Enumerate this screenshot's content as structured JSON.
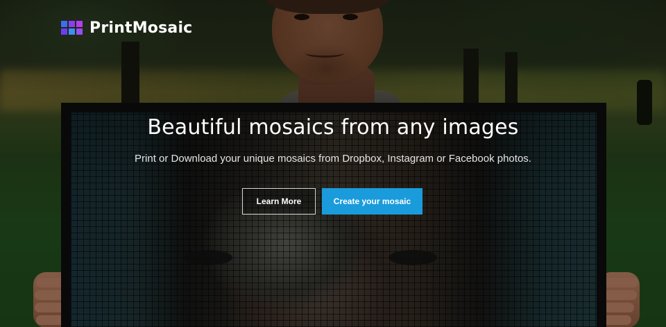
{
  "brand": {
    "name": "PrintMosaic",
    "logo_icon": "mosaic-grid-icon",
    "logo_colors": [
      "#3d6df2",
      "#8a3df2",
      "#b23df2",
      "#6d3df2",
      "#3d8ff2",
      "#9a4df2"
    ]
  },
  "hero": {
    "title": "Beautiful mosaics from any images",
    "subtitle": "Print or Download your unique mosaics from Dropbox, Instagram or Facebook photos."
  },
  "buttons": {
    "learn_more": "Learn More",
    "create": "Create your mosaic"
  },
  "colors": {
    "primary_button": "#1a9bdc",
    "text": "#ffffff"
  }
}
